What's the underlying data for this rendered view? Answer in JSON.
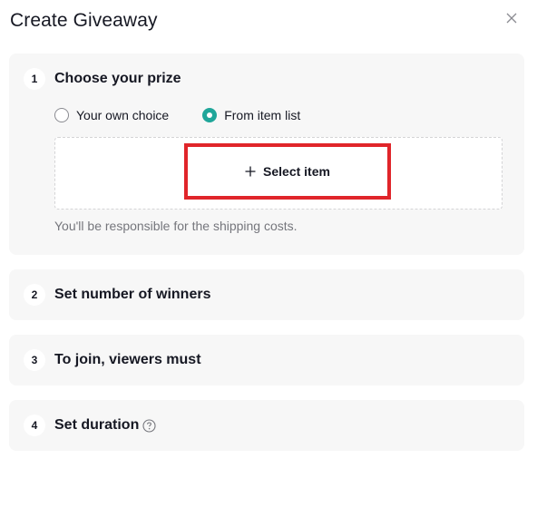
{
  "dialog": {
    "title": "Create Giveaway",
    "close_icon": "close-icon"
  },
  "steps": [
    {
      "number": "1",
      "title": "Choose your prize",
      "options": [
        {
          "label": "Your own choice",
          "checked": false
        },
        {
          "label": "From item list",
          "checked": true
        }
      ],
      "select_button": {
        "icon": "plus-icon",
        "label": "Select item"
      },
      "hint": "You'll be responsible for the shipping costs."
    },
    {
      "number": "2",
      "title": "Set number of winners"
    },
    {
      "number": "3",
      "title": "To join, viewers must"
    },
    {
      "number": "4",
      "title": "Set duration",
      "info_icon": "help-circle-icon"
    }
  ],
  "colors": {
    "accent": "#1fa69a",
    "highlight_border": "#e0252a",
    "card_bg": "#f7f7f7",
    "text_primary": "#161823",
    "text_secondary": "#75767c"
  }
}
